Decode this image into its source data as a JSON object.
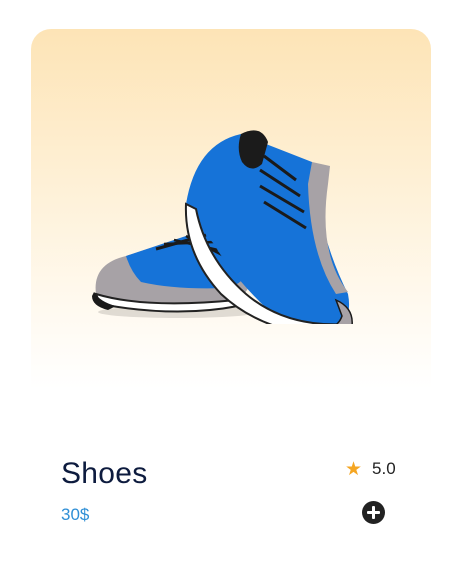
{
  "product": {
    "name": "Shoes",
    "price": "30$",
    "rating": "5.0",
    "image": "blue-sneakers-pair",
    "icons": {
      "rating": "star-icon",
      "add": "plus-circle-icon"
    },
    "colors": {
      "title": "#0d1b3e",
      "price": "#2f8fd6",
      "star": "#f5a623",
      "image_background_top": "#fde4b6"
    }
  }
}
